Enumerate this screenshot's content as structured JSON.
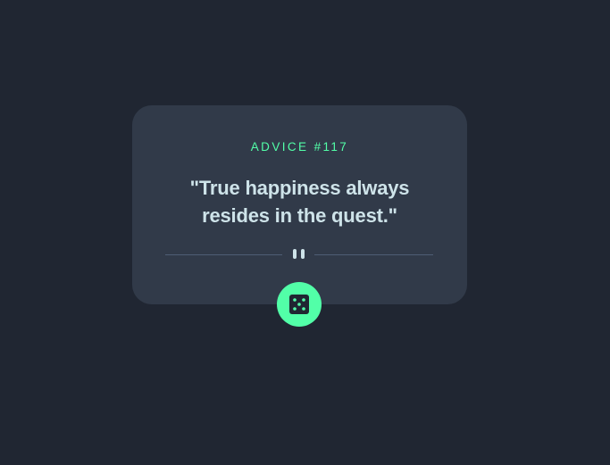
{
  "advice": {
    "label": "ADVICE #117",
    "quote": "\"True happiness always resides in the quest.\""
  },
  "divider": {
    "icon": "pause-icon"
  },
  "button": {
    "icon": "dice-icon",
    "accent": "#52ffa8"
  },
  "colors": {
    "background": "#202632",
    "card": "#313a49",
    "accent": "#52ffa8",
    "text": "#cee3e9",
    "divider": "#4f5d74"
  }
}
